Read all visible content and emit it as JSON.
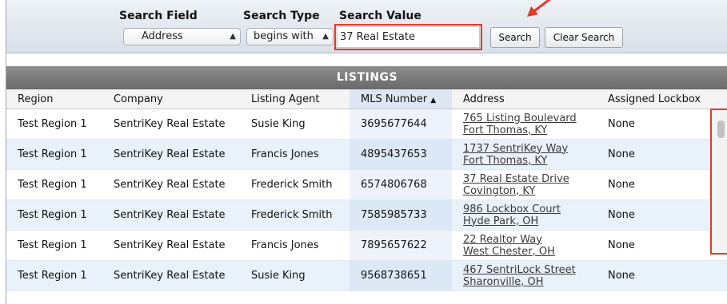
{
  "search": {
    "field_label": "Search Field",
    "type_label": "Search Type",
    "value_label": "Search Value",
    "field_selected": "Address",
    "type_selected": "begins with",
    "value": "37 Real Estate",
    "search_button": "Search",
    "clear_button": "Clear Search"
  },
  "listings": {
    "title": "LISTINGS",
    "columns": [
      "Region",
      "Company",
      "Listing Agent",
      "MLS Number",
      "Address",
      "Assigned Lockbox"
    ],
    "sort_indicator": "▲",
    "rows": [
      {
        "region": "Test Region 1",
        "company": "SentriKey Real Estate",
        "agent": "Susie King",
        "mls": "3695677644",
        "addr1": "765 Listing Boulevard",
        "addr2": "Fort Thomas, KY",
        "lockbox": "None"
      },
      {
        "region": "Test Region 1",
        "company": "SentriKey Real Estate",
        "agent": "Francis Jones",
        "mls": "4895437653",
        "addr1": "1737 SentriKey Way",
        "addr2": "Fort Thomas, KY",
        "lockbox": "None"
      },
      {
        "region": "Test Region 1",
        "company": "SentriKey Real Estate",
        "agent": "Frederick Smith",
        "mls": "6574806768",
        "addr1": "37 Real Estate Drive",
        "addr2": "Covington, KY",
        "lockbox": "None"
      },
      {
        "region": "Test Region 1",
        "company": "SentriKey Real Estate",
        "agent": "Frederick Smith",
        "mls": "7585985733",
        "addr1": "986 Lockbox Court",
        "addr2": "Hyde Park, OH",
        "lockbox": "None"
      },
      {
        "region": "Test Region 1",
        "company": "SentriKey Real Estate",
        "agent": "Francis Jones",
        "mls": "7895657622",
        "addr1": "22 Realtor Way",
        "addr2": "West Chester, OH",
        "lockbox": "None"
      },
      {
        "region": "Test Region 1",
        "company": "SentriKey Real Estate",
        "agent": "Susie King",
        "mls": "9568738651",
        "addr1": "467 SentriLock Street",
        "addr2": "Sharonville, OH",
        "lockbox": "None"
      }
    ]
  },
  "colors": {
    "highlight": "#e03a2a",
    "title_bar": "#7a7a7a",
    "row_alt": "#e9f1fa"
  }
}
